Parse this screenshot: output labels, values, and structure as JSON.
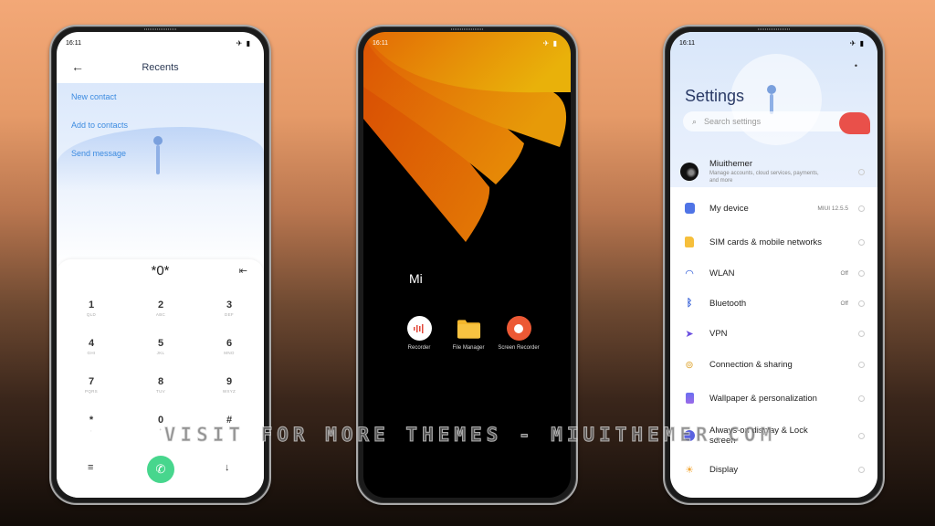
{
  "watermark": "VISIT FOR MORE THEMES - MIUITHEMER.COM",
  "status_time": "16:11",
  "status_icons": "✈ ▮",
  "dialer": {
    "title": "Recents",
    "links": [
      "New contact",
      "Add to contacts",
      "Send message"
    ],
    "dialed": "*0*",
    "keys": [
      {
        "digit": "1",
        "letters": "QLD"
      },
      {
        "digit": "2",
        "letters": "ABC"
      },
      {
        "digit": "3",
        "letters": "DEF"
      },
      {
        "digit": "4",
        "letters": "GHI"
      },
      {
        "digit": "5",
        "letters": "JKL"
      },
      {
        "digit": "6",
        "letters": "MNO"
      },
      {
        "digit": "7",
        "letters": "PQRS"
      },
      {
        "digit": "8",
        "letters": "TUV"
      },
      {
        "digit": "9",
        "letters": "WXYZ"
      },
      {
        "digit": "*",
        "letters": ","
      },
      {
        "digit": "0",
        "letters": "+"
      },
      {
        "digit": "#",
        "letters": ""
      }
    ],
    "icons": {
      "back": "←",
      "backspace": "⇤",
      "menu": "≡",
      "call": "✆",
      "collapse": "↓"
    }
  },
  "home": {
    "folder_name": "Mi",
    "apps": [
      {
        "label": "Recorder"
      },
      {
        "label": "File Manager"
      },
      {
        "label": "Screen Recorder"
      }
    ]
  },
  "settings": {
    "title": "Settings",
    "search_placeholder": "Search settings",
    "items": [
      {
        "label": "Miuithemer",
        "sub": "Manage accounts, cloud services, payments, and more",
        "value": ""
      },
      {
        "label": "My device",
        "sub": "",
        "value": "MIUI 12.5.5"
      },
      {
        "label": "SIM cards & mobile networks",
        "sub": "",
        "value": ""
      },
      {
        "label": "WLAN",
        "sub": "",
        "value": "Off"
      },
      {
        "label": "Bluetooth",
        "sub": "",
        "value": "Off"
      },
      {
        "label": "VPN",
        "sub": "",
        "value": ""
      },
      {
        "label": "Connection & sharing",
        "sub": "",
        "value": ""
      },
      {
        "label": "Wallpaper & personalization",
        "sub": "",
        "value": ""
      },
      {
        "label": "Always-on display & Lock screen",
        "sub": "",
        "value": ""
      },
      {
        "label": "Display",
        "sub": "",
        "value": ""
      }
    ]
  }
}
